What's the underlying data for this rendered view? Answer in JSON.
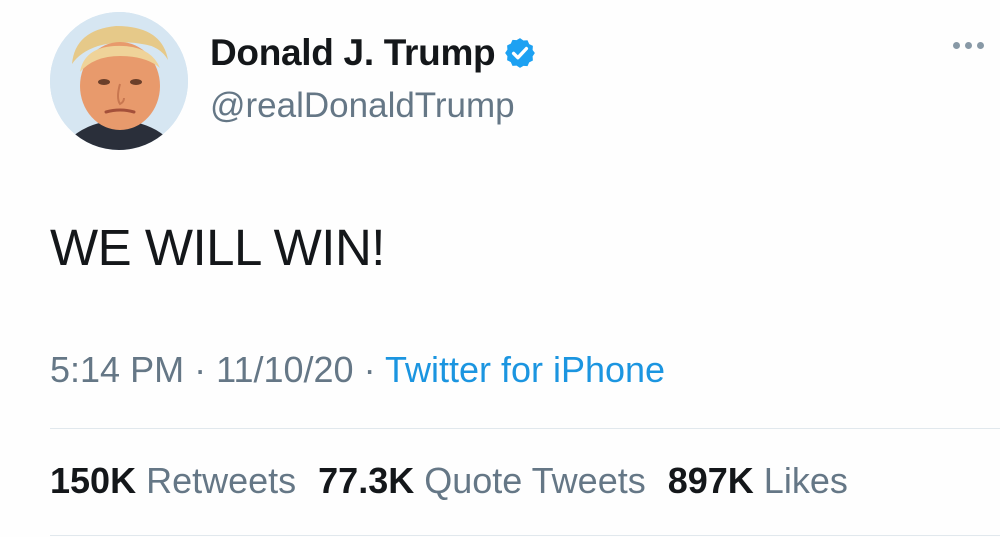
{
  "user": {
    "display_name": "Donald J. Trump",
    "handle": "@realDonaldTrump",
    "verified": true
  },
  "tweet": {
    "text": "WE WILL WIN!",
    "time": "5:14 PM",
    "date": "11/10/20",
    "separator": "·",
    "source": "Twitter for iPhone"
  },
  "stats": {
    "retweets_count": "150K",
    "retweets_label": "Retweets",
    "quote_count": "77.3K",
    "quote_label": "Quote Tweets",
    "likes_count": "897K",
    "likes_label": "Likes"
  },
  "icons": {
    "verified": "verified-badge-icon",
    "more": "more-options-icon"
  },
  "colors": {
    "link": "#1b95e0",
    "verified": "#1da1f2",
    "secondary_text": "#657786",
    "primary_text": "#14171a"
  }
}
